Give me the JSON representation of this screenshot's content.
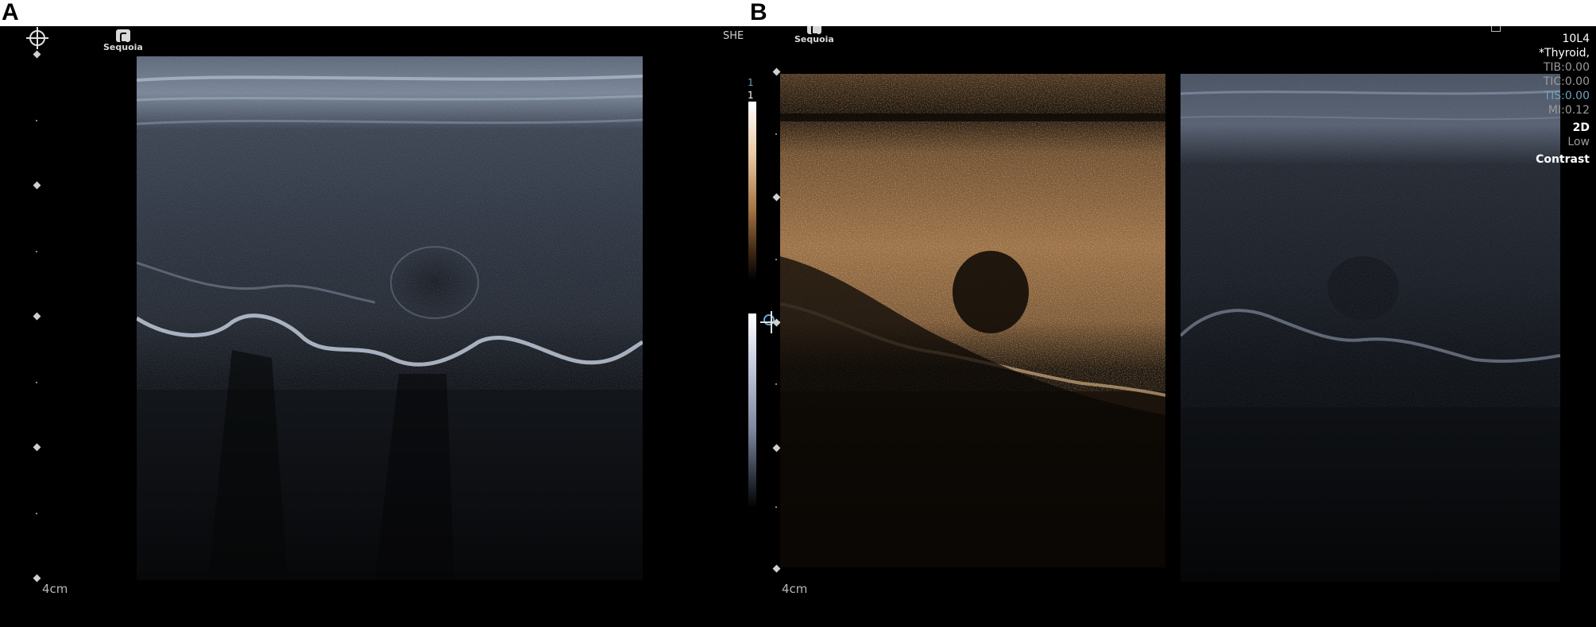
{
  "figure": {
    "panel_a_label": "A",
    "panel_b_label": "B"
  },
  "panel_a": {
    "logo_text": "Sequoia",
    "top_right_text": "SHE",
    "depth_label": "4cm",
    "image_type": "grayscale B-mode ultrasound of thyroid"
  },
  "panel_b": {
    "logo_text": "Sequoia",
    "depth_label": "4cm",
    "colorbar_top_labels": [
      "1",
      "1"
    ],
    "info": {
      "probe": "10L4",
      "preset": "*Thyroid,",
      "tib": "TIB:0.00",
      "tic": "TIC:0.00",
      "tis": "TIS:0.00",
      "mi": "MI:0.12",
      "mode": "2D",
      "power": "Low",
      "contrast": "Contrast"
    },
    "image_left_type": "contrast-enhanced ultrasound (sepia)",
    "image_right_type": "grayscale B-mode ultrasound"
  },
  "colors": {
    "background": "#000000",
    "info_white": "#ffffff",
    "info_gray": "#9a9a9a",
    "info_teal": "#6fa3b8",
    "contrast_sepia": "#c8905a"
  }
}
